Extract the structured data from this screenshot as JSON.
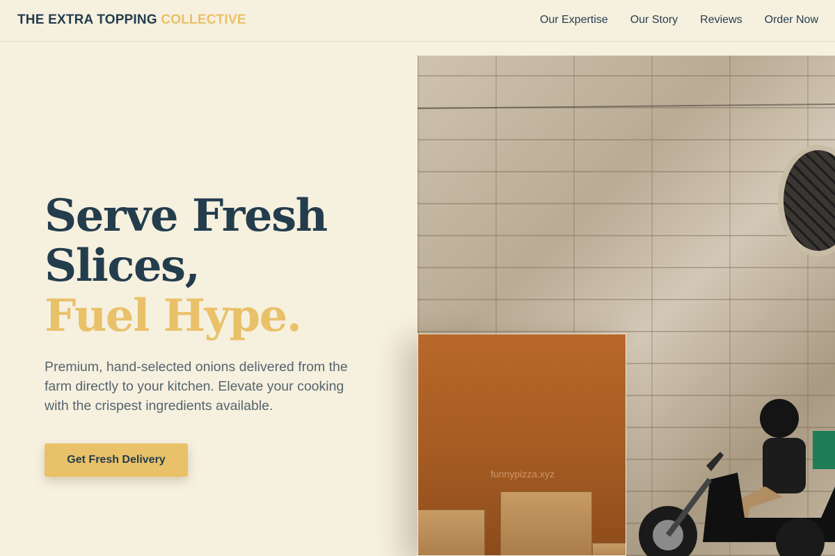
{
  "header": {
    "brand_main": "THE EXTRA TOPPING",
    "brand_accent": "COLLECTIVE",
    "nav": [
      "Our Expertise",
      "Our Story",
      "Reviews",
      "Order Now"
    ]
  },
  "hero": {
    "title_line1": "Serve Fresh",
    "title_line2": "Slices,",
    "title_line3": "Fuel Hype.",
    "description": "Premium, hand-selected onions delivered from the farm directly to your kitchen. Elevate your cooking with the crispest ingredients available.",
    "cta_label": "Get Fresh Delivery"
  },
  "media": {
    "inset_watermark": "funnypizza.xyz",
    "main_photo": "stone-wall-scooter-rider",
    "inset_photo": "cardboard-boxes-orange-wall"
  },
  "colors": {
    "background": "#f6f0df",
    "navy": "#233d4d",
    "accent": "#e9c169",
    "body_text": "#55656e"
  }
}
